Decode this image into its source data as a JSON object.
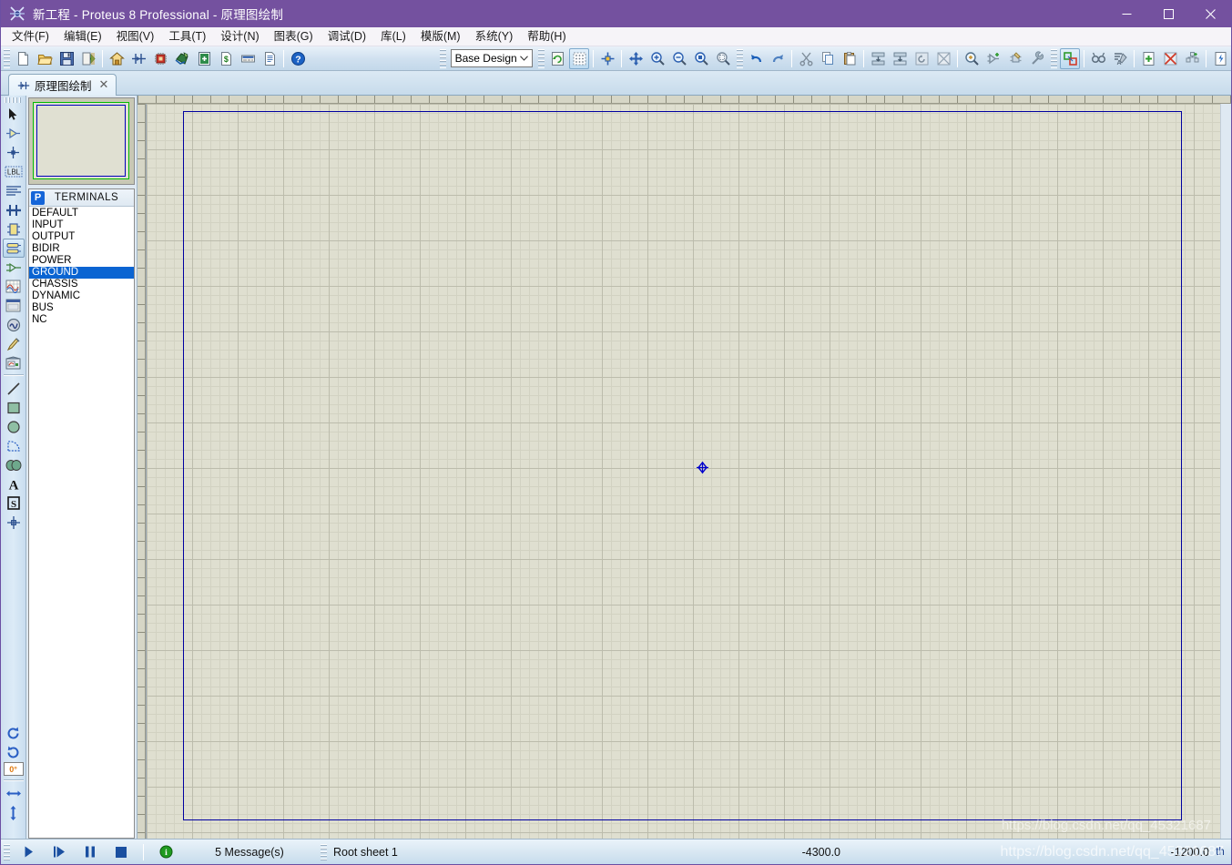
{
  "window": {
    "title": "新工程 - Proteus 8 Professional - 原理图绘制",
    "app_icon": "proteus-icon",
    "minimize_label": "–",
    "maximize_label": "☐",
    "close_label": "✕",
    "titlebar_color": "#74519f"
  },
  "menubar": {
    "items": [
      {
        "label": "文件(F)",
        "name": "menu-file"
      },
      {
        "label": "编辑(E)",
        "name": "menu-edit"
      },
      {
        "label": "视图(V)",
        "name": "menu-view"
      },
      {
        "label": "工具(T)",
        "name": "menu-tools"
      },
      {
        "label": "设计(N)",
        "name": "menu-design"
      },
      {
        "label": "图表(G)",
        "name": "menu-graph"
      },
      {
        "label": "调试(D)",
        "name": "menu-debug"
      },
      {
        "label": "库(L)",
        "name": "menu-library"
      },
      {
        "label": "模版(M)",
        "name": "menu-template"
      },
      {
        "label": "系统(Y)",
        "name": "menu-system"
      },
      {
        "label": "帮助(H)",
        "name": "menu-help"
      }
    ]
  },
  "toolbar": {
    "file_group": [
      "new-project-icon",
      "open-project-icon",
      "save-project-icon",
      "import-export-icon"
    ],
    "module_group": [
      "home-icon",
      "schematic-capture-icon",
      "pcb-layout-icon",
      "3d-viewer-icon",
      "visual-designer-icon",
      "source-code-icon",
      "bill-of-materials-icon",
      "design-explorer-icon",
      "project-notes-icon"
    ],
    "help_group": [
      "help-icon"
    ],
    "design_select": {
      "value": "Base Design",
      "caret": "∨"
    },
    "view_group": [
      "redraw-icon",
      "toggle-grid-icon",
      "origin-icon",
      "pan-icon",
      "zoom-in-icon",
      "zoom-out-icon",
      "zoom-all-icon",
      "zoom-area-icon"
    ],
    "edit_group": [
      "undo-icon",
      "redo-icon",
      "cut-icon",
      "copy-icon",
      "paste-icon"
    ],
    "block_group": [
      "block-copy-icon",
      "block-move-icon",
      "block-rotate-icon",
      "block-delete-icon"
    ],
    "library_group": [
      "pick-parts-icon",
      "make-device-icon",
      "packaging-tool-icon",
      "decompose-icon"
    ],
    "sheet_group": [
      "new-root-sheet-icon",
      "remove-sheet-icon",
      "goto-sheet-icon",
      "exit-sheet-icon",
      "zoom-sheet-icon",
      "netlist-icon"
    ]
  },
  "tabs": [
    {
      "label": "原理图绘制",
      "icon": "schematic-tab-icon",
      "close": "✕",
      "active": true
    }
  ],
  "palette": {
    "mode_tools": [
      {
        "name": "selection-mode-icon",
        "title": "Selection Mode"
      },
      {
        "name": "component-mode-icon",
        "title": "Component Mode"
      },
      {
        "name": "junction-dot-icon",
        "title": "Junction Dot Mode"
      },
      {
        "name": "wire-label-icon",
        "title": "Wire Label Mode",
        "label": "LBL"
      },
      {
        "name": "text-script-icon",
        "title": "Text Script Mode"
      },
      {
        "name": "buses-icon",
        "title": "Buses Mode"
      },
      {
        "name": "subcircuit-icon",
        "title": "Subcircuit Mode"
      },
      {
        "name": "terminals-mode-icon",
        "title": "Terminals Mode",
        "active": true
      },
      {
        "name": "device-pin-icon",
        "title": "Device Pins Mode"
      },
      {
        "name": "graph-mode-icon",
        "title": "Graph Mode"
      },
      {
        "name": "tape-recorder-icon",
        "title": "Tape Recorder"
      },
      {
        "name": "generator-icon",
        "title": "Generator Mode"
      },
      {
        "name": "voltage-probe-icon",
        "title": "Voltage Probe Mode"
      },
      {
        "name": "virtual-instrument-icon",
        "title": "Virtual Instruments Mode"
      }
    ],
    "graphics_tools": [
      {
        "name": "line-icon",
        "title": "2D Graphics Line"
      },
      {
        "name": "box-icon",
        "title": "2D Graphics Box"
      },
      {
        "name": "circle-icon",
        "title": "2D Graphics Circle"
      },
      {
        "name": "arc-icon",
        "title": "2D Graphics Arc"
      },
      {
        "name": "path-icon",
        "title": "2D Graphics Path"
      },
      {
        "name": "text-icon",
        "title": "2D Graphics Text",
        "label": "A"
      },
      {
        "name": "symbol-icon",
        "title": "2D Graphics Symbol",
        "label": "S"
      },
      {
        "name": "marker-icon",
        "title": "2D Graphics Marker"
      }
    ],
    "orientation_tools": [
      {
        "name": "rotate-clockwise-icon",
        "title": "Rotate Clockwise"
      },
      {
        "name": "rotate-anticlockwise-icon",
        "title": "Rotate Anti-clockwise"
      }
    ],
    "angle_value": "0°",
    "mirror_tools": [
      {
        "name": "mirror-horizontal-icon",
        "title": "Mirror Horizontally"
      },
      {
        "name": "mirror-vertical-icon",
        "title": "Mirror Vertically"
      }
    ]
  },
  "preview": {
    "name": "overview-preview-panel",
    "viewport_color": "#00bb00",
    "sheet_color": "#0000bb"
  },
  "object_selector": {
    "pick_button": "P",
    "title": "TERMINALS",
    "items": [
      {
        "label": "DEFAULT",
        "selected": false
      },
      {
        "label": "INPUT",
        "selected": false
      },
      {
        "label": "OUTPUT",
        "selected": false
      },
      {
        "label": "BIDIR",
        "selected": false
      },
      {
        "label": "POWER",
        "selected": false
      },
      {
        "label": "GROUND",
        "selected": true
      },
      {
        "label": "CHASSIS",
        "selected": false
      },
      {
        "label": "DYNAMIC",
        "selected": false
      },
      {
        "label": "BUS",
        "selected": false
      },
      {
        "label": "NC",
        "selected": false
      }
    ]
  },
  "canvas": {
    "name": "schematic-canvas",
    "background_color": "#dfdfd0",
    "grid_color": "#bcbcac",
    "sheet_border_color": "#0000a0",
    "cursor_marker_color": "#0000cc",
    "watermark": "https://blog.csdn.net/qq_45321687"
  },
  "statusbar": {
    "animation_controls": [
      {
        "name": "play-button",
        "glyph": "play"
      },
      {
        "name": "step-button",
        "glyph": "step"
      },
      {
        "name": "pause-button",
        "glyph": "pause"
      },
      {
        "name": "stop-button",
        "glyph": "stop"
      }
    ],
    "info_icon": "info-icon",
    "messages": "5 Message(s)",
    "sheet": "Root sheet 1",
    "coord_x": "-4300.0",
    "coord_y": "-1200.0",
    "units": "th"
  }
}
